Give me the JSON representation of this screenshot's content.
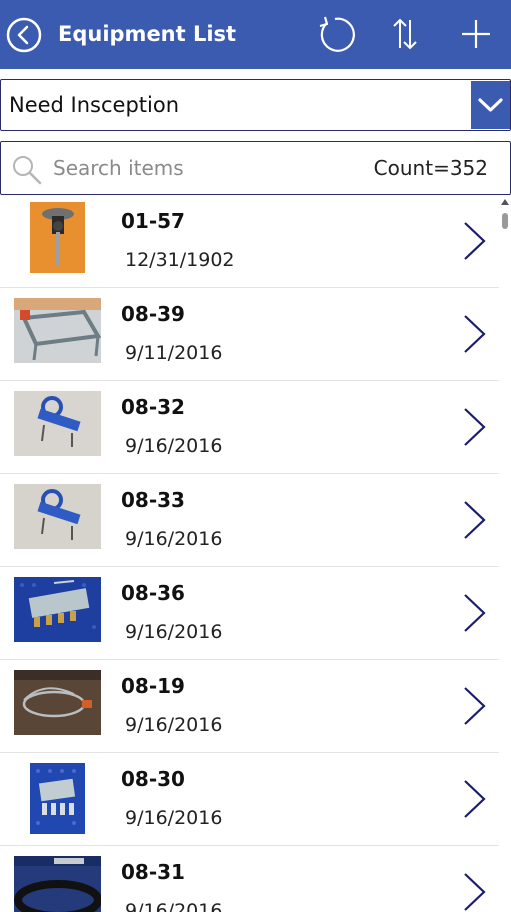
{
  "header": {
    "title": "Equipment List",
    "back_icon": "back-arrow-circle-icon",
    "refresh_icon": "refresh-icon",
    "sort_icon": "sort-icon",
    "add_icon": "plus-icon",
    "background_color": "#3a5bb0"
  },
  "filter": {
    "selected": "Need Insception",
    "chevron_icon": "chevron-down-icon"
  },
  "search": {
    "placeholder": "Search items",
    "value": "",
    "count": "Count=352"
  },
  "items": [
    {
      "id": "01-57",
      "date": "12/31/1902",
      "thumbnail": "orange vise clamp photo"
    },
    {
      "id": "08-39",
      "date": "9/11/2016",
      "thumbnail": "steel frame fixture photo"
    },
    {
      "id": "08-32",
      "date": "9/16/2016",
      "thumbnail": "blue clamp photo"
    },
    {
      "id": "08-33",
      "date": "9/16/2016",
      "thumbnail": "blue clamp photo"
    },
    {
      "id": "08-36",
      "date": "9/16/2016",
      "thumbnail": "valve block on pegboard photo"
    },
    {
      "id": "08-19",
      "date": "9/16/2016",
      "thumbnail": "cable on table photo"
    },
    {
      "id": "08-30",
      "date": "9/16/2016",
      "thumbnail": "manifold on pegboard photo"
    },
    {
      "id": "08-31",
      "date": "9/16/2016",
      "thumbnail": "black ring photo"
    }
  ]
}
